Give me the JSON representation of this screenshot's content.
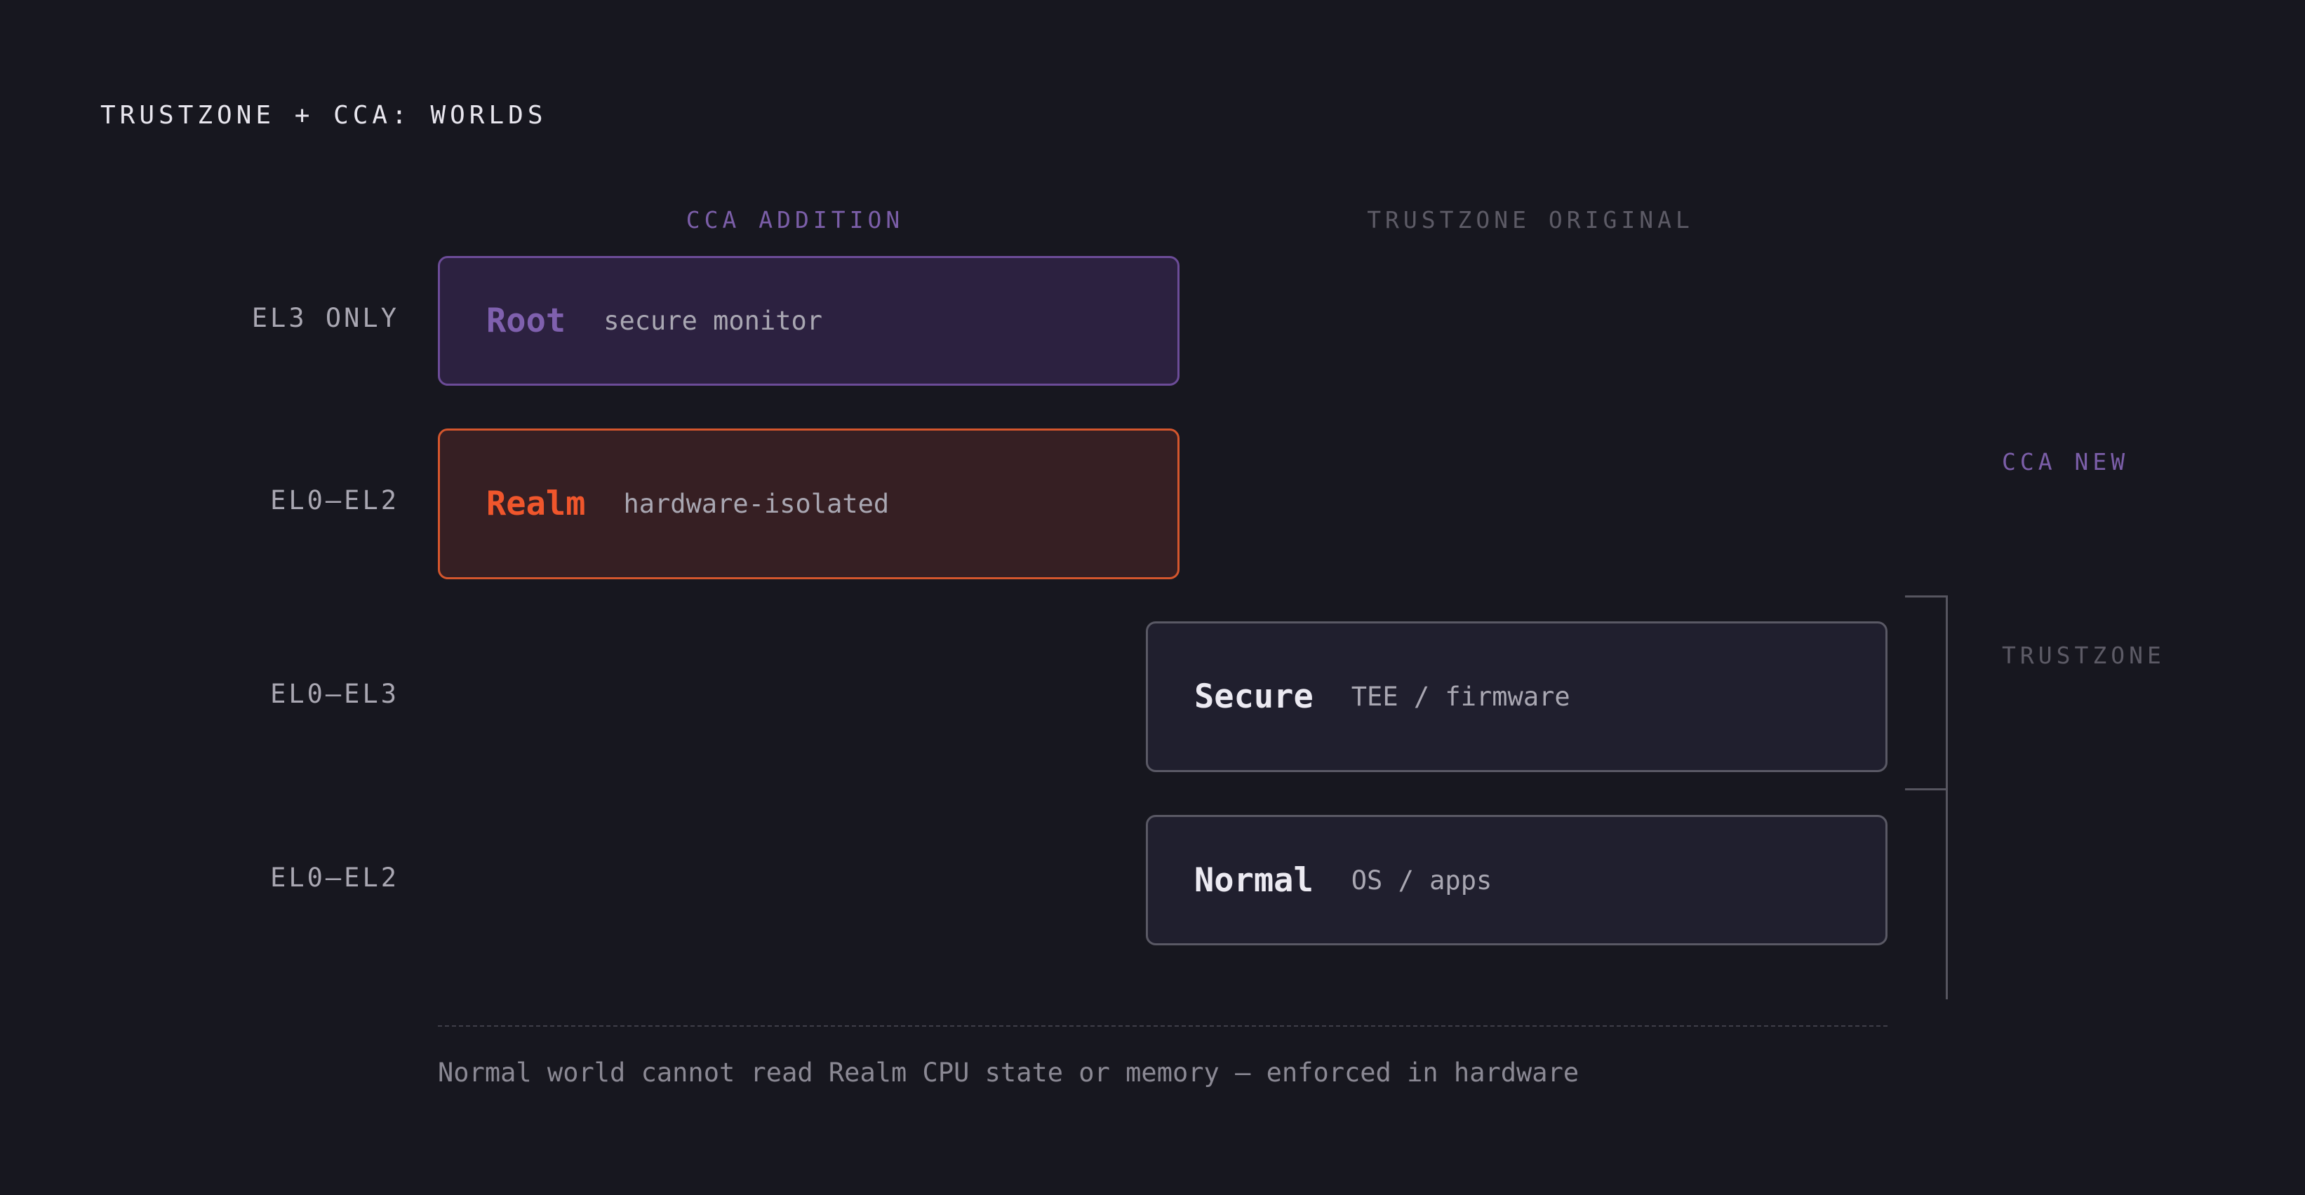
{
  "title": "TRUSTZONE + CCA: WORLDS",
  "columns": {
    "cca": "CCA ADDITION",
    "trustzone": "TRUSTZONE ORIGINAL"
  },
  "levels": {
    "root": "EL3 ONLY",
    "realm": "EL0–EL2",
    "secure": "EL0–EL3",
    "normal": "EL0–EL2"
  },
  "worlds": {
    "root": {
      "name": "Root",
      "desc": "secure monitor"
    },
    "realm": {
      "name": "Realm",
      "desc": "hardware-isolated"
    },
    "secure": {
      "name": "Secure",
      "desc": "TEE / firmware"
    },
    "normal": {
      "name": "Normal",
      "desc": "OS / apps"
    }
  },
  "side_labels": {
    "cca": "CCA NEW",
    "trustzone": "TRUSTZONE"
  },
  "footnote": "Normal world cannot read Realm CPU state or memory — enforced in hardware",
  "colors": {
    "background": "#17171f",
    "root_accent": "#7f60ae",
    "realm_accent": "#f0562c",
    "trustzone_border": "#5a5965"
  }
}
